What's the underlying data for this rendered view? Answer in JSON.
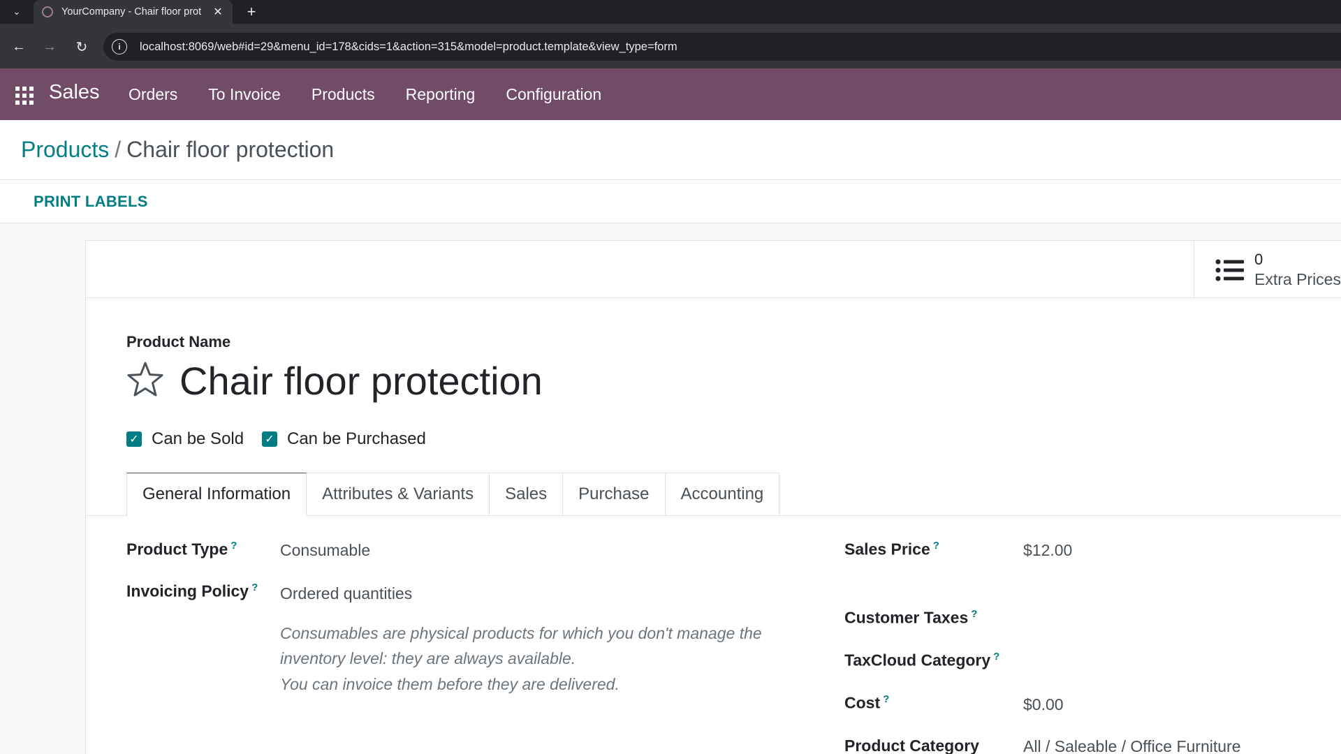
{
  "browser": {
    "tab_title": "YourCompany - Chair floor prot",
    "url": "localhost:8069/web#id=29&menu_id=178&cids=1&action=315&model=product.template&view_type=form"
  },
  "navbar": {
    "app_name": "Sales",
    "menu": [
      "Orders",
      "To Invoice",
      "Products",
      "Reporting",
      "Configuration"
    ]
  },
  "breadcrumb": {
    "parent": "Products",
    "separator": "/",
    "current": "Chair floor protection"
  },
  "actions": {
    "print_labels": "PRINT LABELS"
  },
  "stat_button": {
    "value": "0",
    "label": "Extra Prices",
    "icon": "list-icon"
  },
  "product": {
    "name_label": "Product Name",
    "name": "Chair floor protection",
    "can_be_sold_label": "Can be Sold",
    "can_be_sold": true,
    "can_be_purchased_label": "Can be Purchased",
    "can_be_purchased": true
  },
  "tabs": [
    "General Information",
    "Attributes & Variants",
    "Sales",
    "Purchase",
    "Accounting"
  ],
  "active_tab": "General Information",
  "general": {
    "product_type_label": "Product Type",
    "product_type": "Consumable",
    "invoicing_policy_label": "Invoicing Policy",
    "invoicing_policy": "Ordered quantities",
    "note_consumable": "Consumables are physical products for which you don't manage the inventory level: they are always available.",
    "note_invoice": "You can invoice them before they are delivered.",
    "sales_price_label": "Sales Price",
    "sales_price": "$12.00",
    "customer_taxes_label": "Customer Taxes",
    "taxcloud_category_label": "TaxCloud Category",
    "cost_label": "Cost",
    "cost": "$0.00",
    "product_category_label": "Product Category",
    "product_category": "All / Saleable / Office Furniture",
    "help_mark": "?"
  },
  "colors": {
    "brand": "#714b67",
    "accent": "#017e84"
  }
}
